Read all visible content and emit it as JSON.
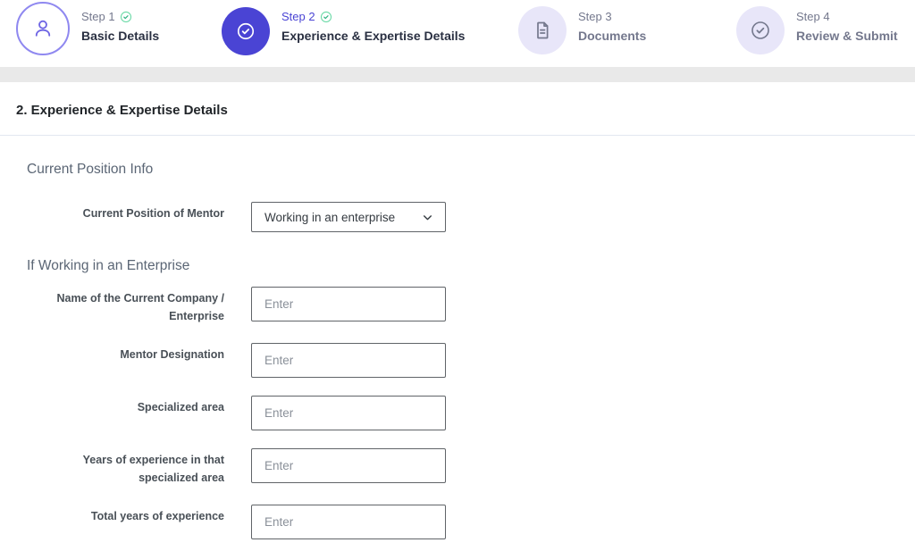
{
  "stepper": {
    "steps": [
      {
        "label": "Step 1",
        "title": "Basic Details",
        "status": "completed"
      },
      {
        "label": "Step 2",
        "title": "Experience & Expertise Details",
        "status": "active-completed"
      },
      {
        "label": "Step 3",
        "title": "Documents",
        "status": "pending"
      },
      {
        "label": "Step 4",
        "title": "Review & Submit",
        "status": "pending"
      }
    ]
  },
  "page": {
    "title": "2. Experience & Expertise Details"
  },
  "form": {
    "section1_heading": "Current Position Info",
    "section2_heading": "If Working in an Enterprise",
    "placeholder": "Enter",
    "position_field": {
      "label": "Current Position of Mentor",
      "value": "Working in an enterprise"
    },
    "fields": [
      {
        "label": "Name of the Current Company /\nEnterprise"
      },
      {
        "label": "Mentor Designation"
      },
      {
        "label": "Specialized area"
      },
      {
        "label": "Years of experience in that\nspecialized area"
      },
      {
        "label": "Total years of experience"
      }
    ]
  },
  "colors": {
    "primary": "#4a44d4",
    "primary_light_border": "#8f88f0",
    "step_pending_bg": "#e8e6f9",
    "muted_text": "#74788d",
    "dark_text": "#2a3042",
    "success_check": "#41cb8f",
    "band_gray": "#e9e9e9",
    "input_border": "#606468"
  }
}
